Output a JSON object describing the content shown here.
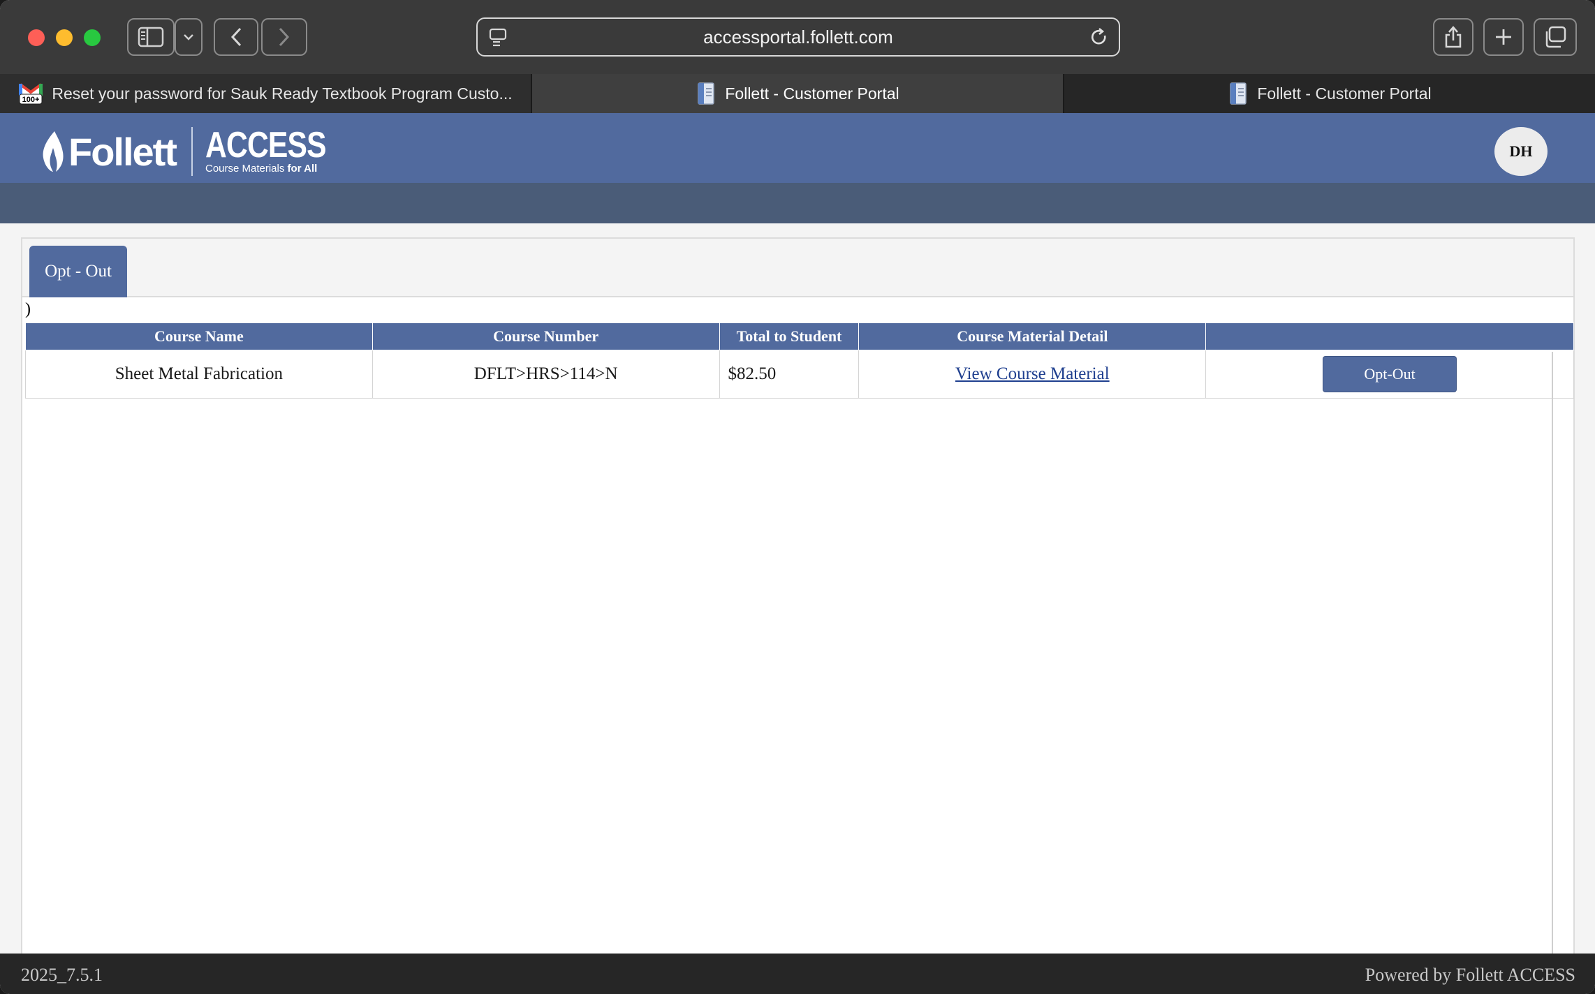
{
  "browser": {
    "url": "accessportal.follett.com",
    "tabs": [
      {
        "title": "Reset your password for Sauk Ready Textbook Program Custo...",
        "icon": "gmail-icon",
        "badge": "100+"
      },
      {
        "title": "Follett - Customer Portal",
        "icon": "document-icon"
      },
      {
        "title": "Follett - Customer Portal",
        "icon": "document-icon"
      }
    ]
  },
  "header": {
    "brand": "Follett",
    "product": "ACCESS",
    "tagline_prefix": "Course Materials ",
    "tagline_bold": "for All",
    "user_initials": "DH",
    "accent_color": "#516a9e"
  },
  "content": {
    "tab_label": "Opt - Out",
    "stray_text": ")",
    "table": {
      "headers": [
        "Course Name",
        "Course Number",
        "Total to Student",
        "Course Material Detail",
        ""
      ],
      "rows": [
        {
          "course_name": "Sheet Metal Fabrication",
          "course_number": "DFLT>HRS>114>N",
          "total": "$82.50",
          "detail_link": "View Course Material",
          "action": "Opt-Out"
        }
      ]
    }
  },
  "footer": {
    "version": "2025_7.5.1",
    "powered_by": "Powered by Follett ACCESS"
  }
}
